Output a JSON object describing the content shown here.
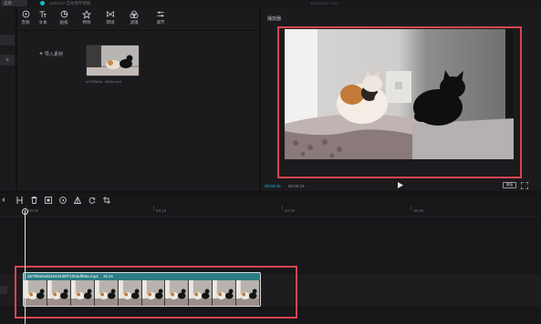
{
  "topbar": {
    "menu_label": "菜单",
    "project_title": "1222112 自动保存草稿",
    "center_title": "20180204 1212"
  },
  "left_strip": {
    "items": [
      "",
      "本"
    ]
  },
  "media": {
    "tools": [
      {
        "label": "音频",
        "icon": "music-icon"
      },
      {
        "label": "文本",
        "icon": "text-icon"
      },
      {
        "label": "贴纸",
        "icon": "sticker-icon"
      },
      {
        "label": "特效",
        "icon": "effects-icon"
      },
      {
        "label": "转场",
        "icon": "transition-icon"
      },
      {
        "label": "滤镜",
        "icon": "filter-icon"
      },
      {
        "label": "调节",
        "icon": "adjust-icon"
      }
    ],
    "import_label": "导入素材",
    "thumb_caption": "a5789a0a...d68a.mp4"
  },
  "player": {
    "title": "播放器",
    "time_current": "00:00:00",
    "time_total": "00:00:19",
    "ratio_label": "原始"
  },
  "timeline": {
    "ruler": [
      "00:00",
      "00:10",
      "00:20",
      "00:30"
    ],
    "clip_name": "a5789a0a4b45434d9f7150adf68a.mp4",
    "clip_duration": "18.2s"
  },
  "colors": {
    "accent": "#1fb6c6",
    "highlight_box": "#d84550",
    "clip_teal": "#2b7c86",
    "background": "#121214"
  }
}
